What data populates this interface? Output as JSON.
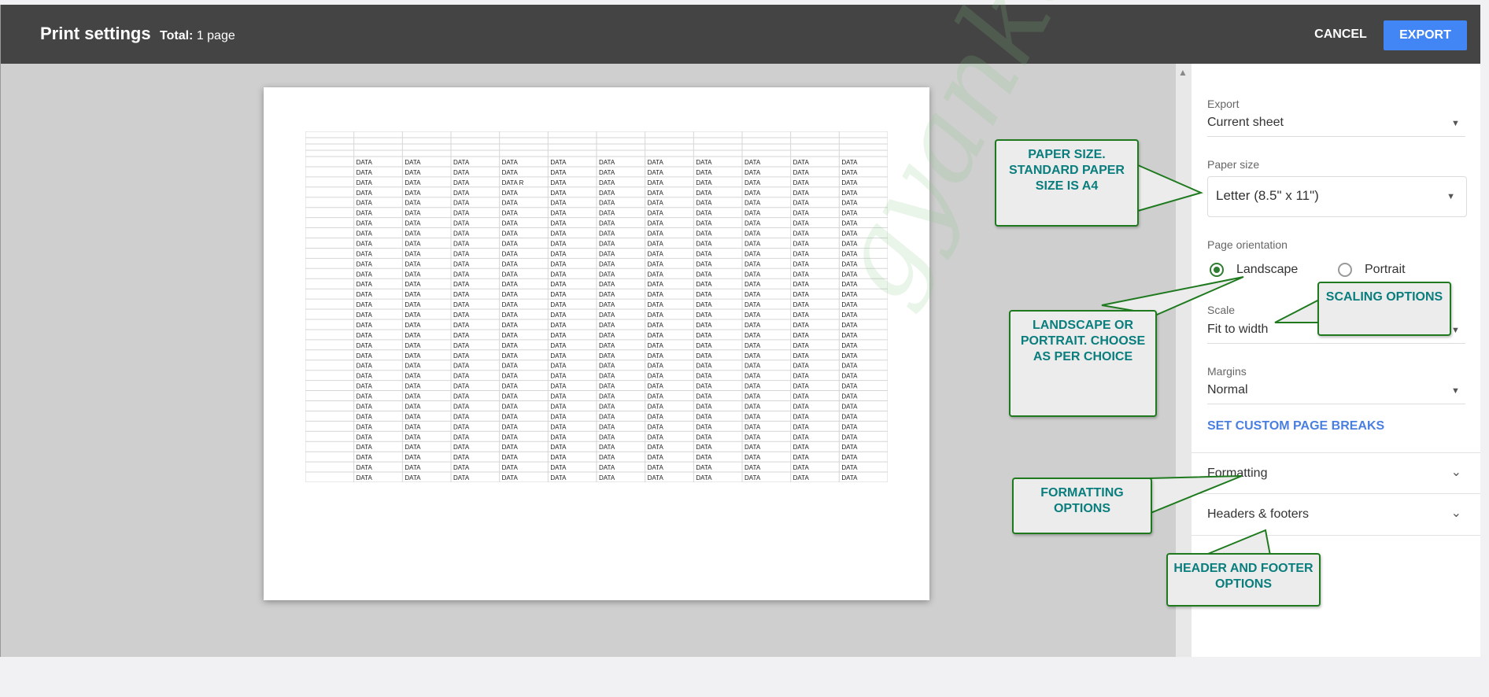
{
  "header": {
    "title": "Print settings",
    "total_label": "Total:",
    "total_value": "1 page",
    "cancel_label": "CANCEL",
    "export_label": "EXPORT"
  },
  "preview": {
    "cell_text": "DATA",
    "cell_text_variant": "DATA R",
    "columns": 11,
    "data_rows": 32,
    "watermark": "gyankosh.net"
  },
  "panel": {
    "export": {
      "label": "Export",
      "value": "Current sheet"
    },
    "paper_size": {
      "label": "Paper size",
      "value": "Letter (8.5\" x 11\")"
    },
    "orientation": {
      "label": "Page orientation",
      "options": [
        {
          "label": "Landscape",
          "selected": true
        },
        {
          "label": "Portrait",
          "selected": false
        }
      ]
    },
    "scale": {
      "label": "Scale",
      "value": "Fit to width"
    },
    "margins": {
      "label": "Margins",
      "value": "Normal"
    },
    "custom_breaks_label": "SET CUSTOM PAGE BREAKS",
    "sections": [
      "Formatting",
      "Headers & footers"
    ]
  },
  "callouts": {
    "paper": "PAPER SIZE. STANDARD PAPER SIZE IS A4",
    "orientation": "LANDSCAPE OR PORTRAIT. CHOOSE AS PER CHOICE",
    "scaling": "SCALING OPTIONS",
    "formatting": "FORMATTING OPTIONS",
    "header_footer": "HEADER AND FOOTER OPTIONS"
  },
  "colors": {
    "header_bg": "#444444",
    "accent": "#4285f4",
    "radio_selected": "#2e7d32",
    "callout_text": "#0a7d7d",
    "callout_border": "#1f7a1f"
  }
}
